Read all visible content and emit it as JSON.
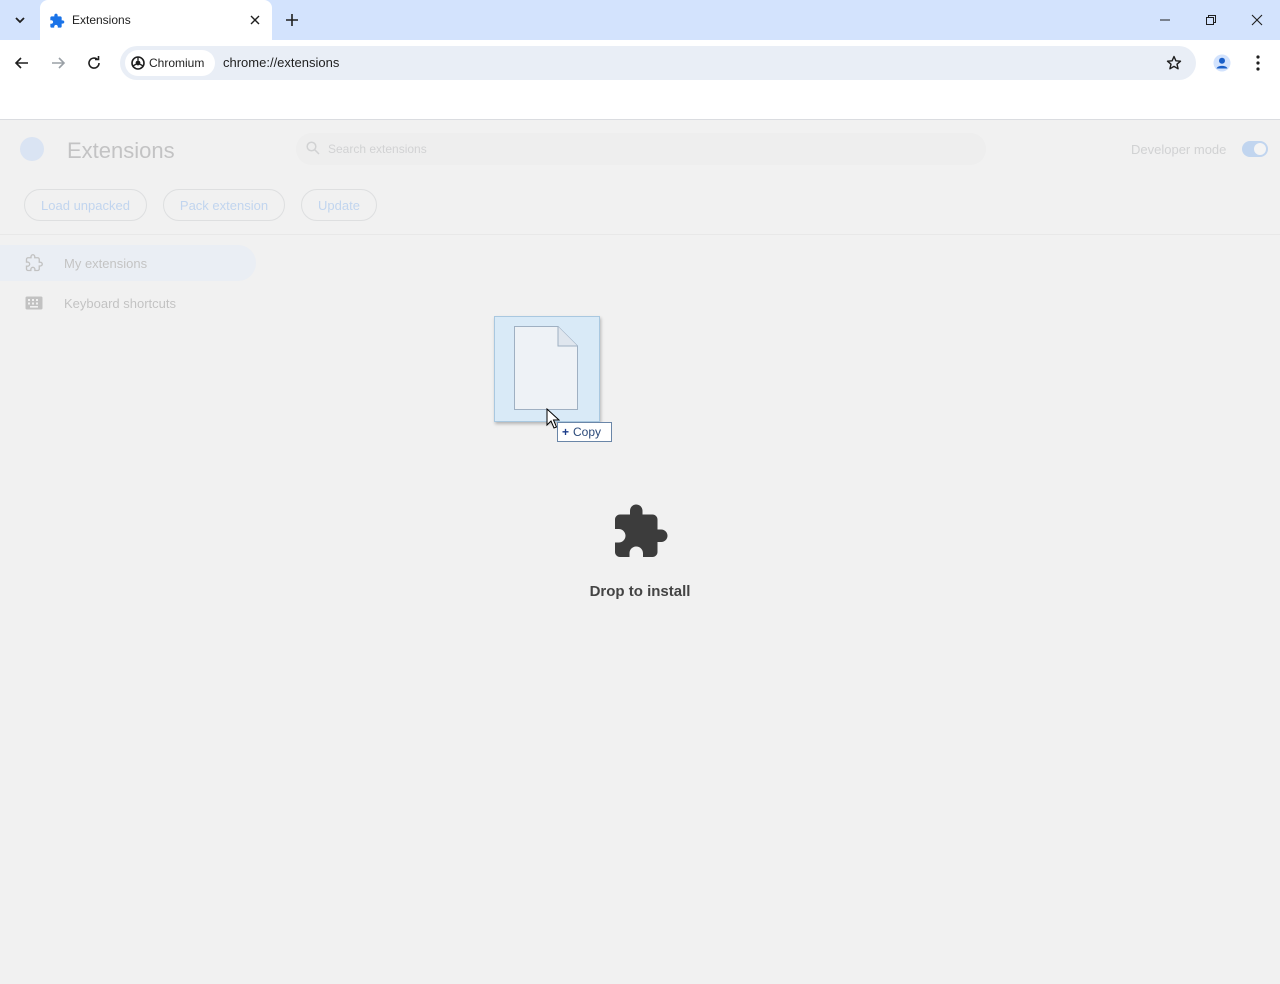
{
  "tabs": [
    {
      "title": "Extensions",
      "icon": "puzzle-icon",
      "active": true
    }
  ],
  "toolbar": {
    "site_chip": "Chromium",
    "url": "chrome://extensions"
  },
  "page": {
    "title": "Extensions",
    "search_placeholder": "Search extensions",
    "developer_mode_label": "Developer mode",
    "developer_mode_on": true,
    "buttons": {
      "load_unpacked": "Load unpacked",
      "pack_extension": "Pack extension",
      "update": "Update"
    },
    "sidebar": [
      {
        "label": "My extensions",
        "icon": "extension-icon",
        "active": true
      },
      {
        "label": "Keyboard shortcuts",
        "icon": "keyboard-icon",
        "active": false
      }
    ]
  },
  "drop": {
    "text": "Drop to install",
    "icon": "puzzle-icon"
  },
  "drag": {
    "copy_label": "Copy",
    "icon": "file-icon"
  },
  "colors": {
    "tabstrip": "#d3e3fd",
    "accent": "#1a73e8",
    "page_bg": "#f1f1f1"
  }
}
